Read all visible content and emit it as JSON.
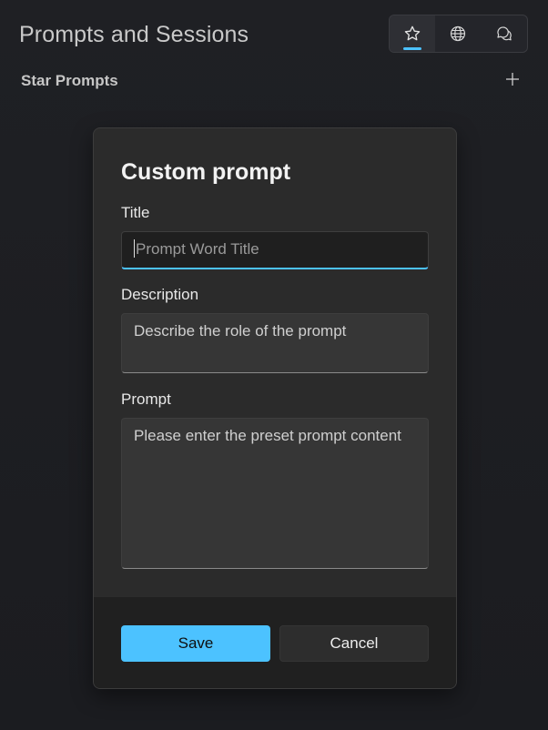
{
  "header": {
    "title": "Prompts and Sessions",
    "tabs": [
      {
        "icon": "star-icon",
        "active": true
      },
      {
        "icon": "globe-icon",
        "active": false
      },
      {
        "icon": "chat-icon",
        "active": false
      }
    ],
    "accent": "#4cc2ff"
  },
  "section": {
    "label": "Star Prompts",
    "add_icon": "plus-icon"
  },
  "dialog": {
    "title": "Custom prompt",
    "fields": {
      "title_label": "Title",
      "title_placeholder": "Prompt Word Title",
      "description_label": "Description",
      "description_placeholder": "Describe the role of the prompt",
      "prompt_label": "Prompt",
      "prompt_placeholder": "Please enter the preset prompt content"
    },
    "buttons": {
      "save": "Save",
      "cancel": "Cancel"
    }
  }
}
